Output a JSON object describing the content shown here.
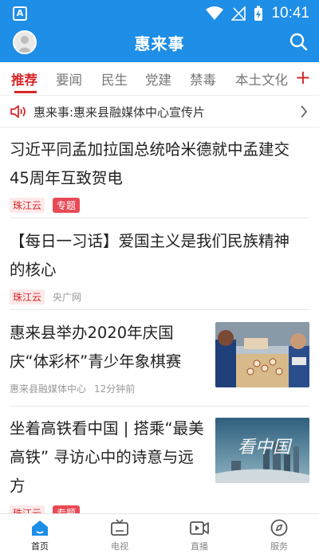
{
  "statusbar": {
    "time": "10:41",
    "left_glyph": "A"
  },
  "header": {
    "title": "惠来事"
  },
  "tabs": [
    {
      "label": "推荐",
      "active": true
    },
    {
      "label": "要闻",
      "active": false
    },
    {
      "label": "民生",
      "active": false
    },
    {
      "label": "党建",
      "active": false
    },
    {
      "label": "禁毒",
      "active": false
    },
    {
      "label": "本土文化",
      "active": false
    }
  ],
  "tabs_add": "+",
  "notice": {
    "text": "惠来事:惠来县融媒体中心宣传片"
  },
  "news": [
    {
      "title_line1": "习近平同孟加拉国总统哈米德就中孟建交",
      "title_line2": "45周年互致贺电",
      "source_tag": "珠江云",
      "topic_tag": "专题"
    },
    {
      "title_line1": "【每日一习话】爱国主义是我们民族精神",
      "title_line2": "的核心",
      "source_tag": "珠江云",
      "source2": "央广网"
    },
    {
      "title_line1": "惠来县举办2020年庆国",
      "title_line2": "庆“体彩杯”青少年象棋赛",
      "source": "惠来县融媒体中心",
      "time": "12分钟前",
      "thumb": "chess-match-photo"
    },
    {
      "title_line1": "坐着高铁看中国 | 搭乘“最美",
      "title_line2": "高铁” 寻访心中的诗意与远",
      "title_line3": "方",
      "source_tag": "珠江云",
      "topic_tag": "专题",
      "thumb": "high-speed-rail-china-poster",
      "thumb_text": "看中国"
    }
  ],
  "bottomnav": [
    {
      "label": "首页",
      "icon": "home-icon",
      "active": true
    },
    {
      "label": "电视",
      "icon": "tv-icon",
      "active": false
    },
    {
      "label": "直播",
      "icon": "live-video-icon",
      "active": false
    },
    {
      "label": "服务",
      "icon": "compass-icon",
      "active": false
    }
  ],
  "colors": {
    "brand_blue": "#1e8ee6",
    "accent_red": "#d6292b"
  }
}
